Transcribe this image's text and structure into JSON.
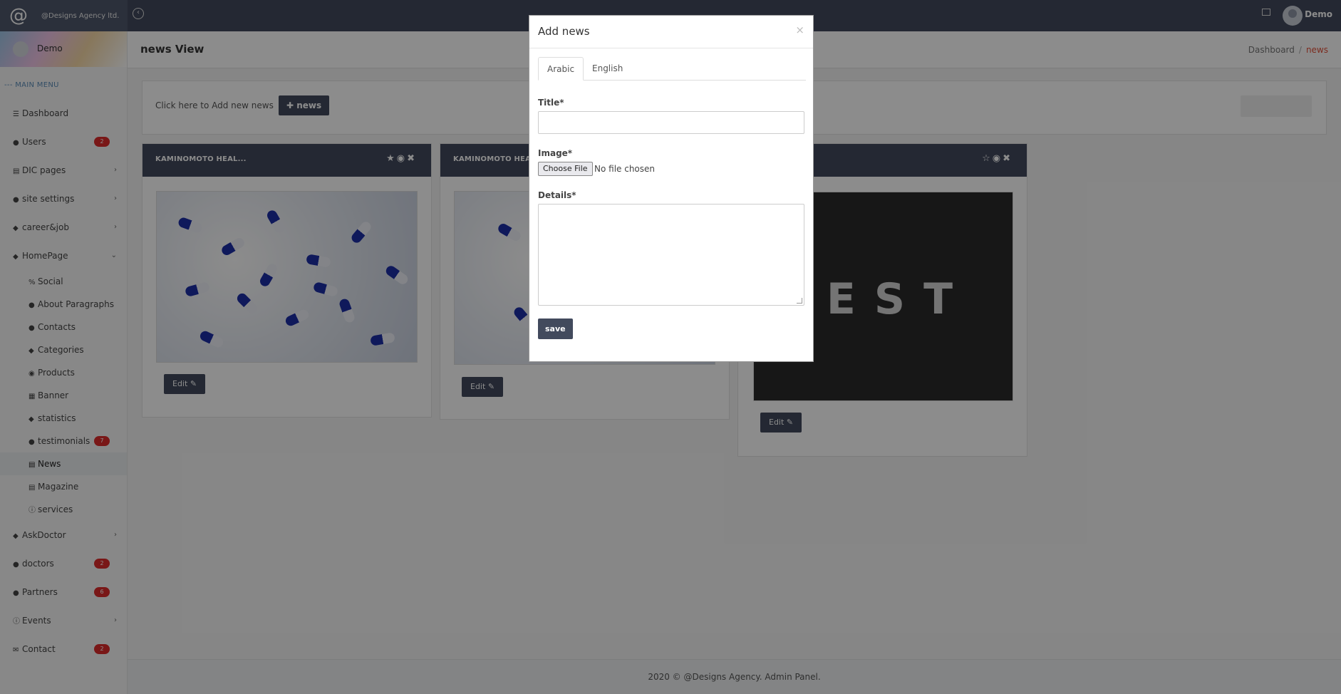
{
  "brand": {
    "name": "@Designs Agency ltd."
  },
  "topbar": {
    "user_name": "Demo"
  },
  "sidebar": {
    "profile_name": "Demo",
    "menu_title": "MAIN MENU",
    "items": [
      {
        "label": "Dashboard",
        "icon": "bars-icon"
      },
      {
        "label": "Users",
        "icon": "users-icon",
        "badge": "2"
      },
      {
        "label": "DIC pages",
        "icon": "list-icon"
      },
      {
        "label": "site settings",
        "icon": "circle-icon"
      },
      {
        "label": "career&job",
        "icon": "tag-icon"
      },
      {
        "label": "HomePage",
        "icon": "tag-icon"
      }
    ],
    "sub_items": [
      {
        "label": "Social",
        "icon": "link-icon"
      },
      {
        "label": "About Paragraphs",
        "icon": "circle-icon"
      },
      {
        "label": "Contacts",
        "icon": "circle-icon"
      },
      {
        "label": "Categories",
        "icon": "tag-icon"
      },
      {
        "label": "Products",
        "icon": "product-icon"
      },
      {
        "label": "Banner",
        "icon": "image-icon"
      },
      {
        "label": "statistics",
        "icon": "tag-icon"
      },
      {
        "label": "testimonials",
        "icon": "circle-icon",
        "badge": "7"
      },
      {
        "label": "News",
        "icon": "newspaper-icon"
      },
      {
        "label": "Magazine",
        "icon": "newspaper-icon"
      },
      {
        "label": "services",
        "icon": "info-icon"
      }
    ],
    "items_after": [
      {
        "label": "AskDoctor",
        "icon": "tag-icon"
      },
      {
        "label": "doctors",
        "icon": "circle-icon",
        "badge": "2"
      },
      {
        "label": "Partners",
        "icon": "users-icon",
        "badge": "6"
      },
      {
        "label": "Events",
        "icon": "info-icon"
      },
      {
        "label": "Contact",
        "icon": "envelope-icon",
        "badge": "2"
      }
    ]
  },
  "header": {
    "title": "news View",
    "breadcrumb": [
      "Dashboard",
      "news"
    ]
  },
  "add_panel": {
    "text": "Click here to Add new news",
    "button_label": "news"
  },
  "cards": [
    {
      "title": "KAMINOMOTO HEAL...",
      "edit_label": "Edit"
    },
    {
      "title": "KAMINOMOTO HEAL...",
      "edit_label": "Edit"
    },
    {
      "title": "",
      "image_text": "TEST",
      "edit_label": "Edit"
    }
  ],
  "modal": {
    "title": "Add news",
    "tabs": [
      "Arabic",
      "English"
    ],
    "active_tab": "Arabic",
    "title_label": "Title*",
    "title_value": "",
    "image_label": "Image*",
    "file_button": "Choose File",
    "file_status": "No file chosen",
    "details_label": "Details*",
    "details_value": "",
    "save_label": "save"
  },
  "footer": {
    "text": "2020 © @Designs Agency. Admin Panel."
  },
  "colors": {
    "navbar": "#424a5d",
    "badge": "#dd2a2a",
    "breadcrumb_active": "#e2513a"
  }
}
